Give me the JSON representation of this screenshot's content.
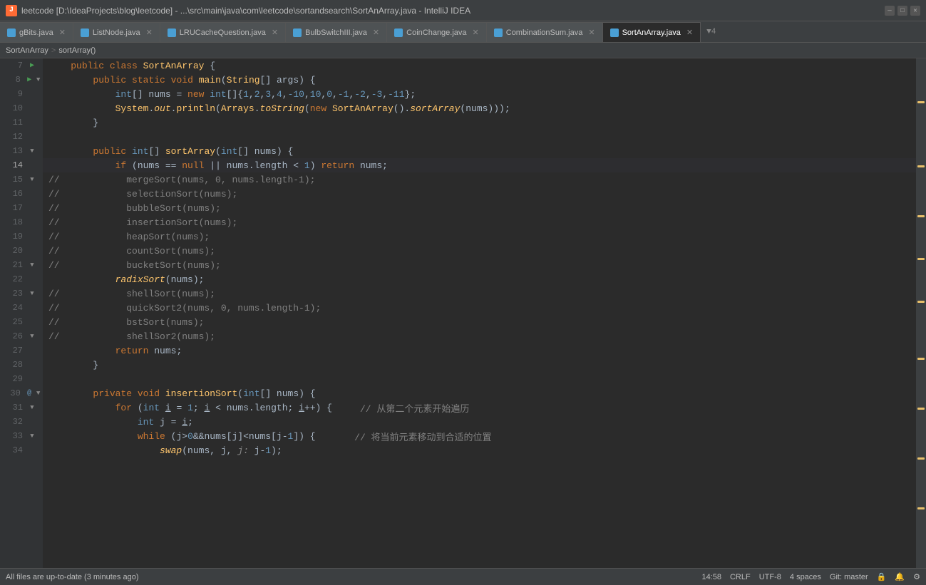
{
  "titleBar": {
    "title": "leetcode [D:\\IdeaProjects\\blog\\leetcode] - ...\\src\\main\\java\\com\\leetcode\\sortandsearch\\SortAnArray.java - IntelliJ IDEA",
    "appIcon": "J",
    "winBtns": [
      "—",
      "□",
      "✕"
    ]
  },
  "tabs": [
    {
      "id": "gBits",
      "label": "gBits.java",
      "active": false
    },
    {
      "id": "listNode",
      "label": "ListNode.java",
      "active": false
    },
    {
      "id": "lruCache",
      "label": "LRUCacheQuestion.java",
      "active": false
    },
    {
      "id": "bulbSwitch",
      "label": "BulbSwitchIII.java",
      "active": false
    },
    {
      "id": "coinChange",
      "label": "CoinChange.java",
      "active": false
    },
    {
      "id": "combinationSum",
      "label": "CombinationSum.java",
      "active": false
    },
    {
      "id": "sortAnArray",
      "label": "SortAnArray.java",
      "active": true
    }
  ],
  "tabOverflow": "▼4",
  "breadcrumb": {
    "parts": [
      "SortAnArray",
      ">",
      "sortArray()"
    ]
  },
  "lines": [
    {
      "num": 7,
      "runIcon": true,
      "foldIcon": false,
      "code": "    public class SortAnArray {"
    },
    {
      "num": 8,
      "runIcon": true,
      "foldIcon": true,
      "code": "        public static void main(String[] args) {"
    },
    {
      "num": 9,
      "foldIcon": false,
      "code": "            int[] nums = new int[]{1,2,3,4,-10,10,0,-1,-2,-3,-11};"
    },
    {
      "num": 10,
      "foldIcon": false,
      "code": "            System.out.println(Arrays.toString(new SortAnArray().sortArray(nums)));"
    },
    {
      "num": 11,
      "foldIcon": false,
      "code": "        }"
    },
    {
      "num": 12,
      "foldIcon": false,
      "code": ""
    },
    {
      "num": 13,
      "foldIcon": false,
      "code": "        public int[] sortArray(int[] nums) {"
    },
    {
      "num": 14,
      "foldIcon": false,
      "cursor": true,
      "code": "            if (nums == null || nums.length < 1) return nums;"
    },
    {
      "num": 15,
      "foldIcon": true,
      "commented": true,
      "code": "//            mergeSort(nums, 0, nums.length-1);"
    },
    {
      "num": 16,
      "foldIcon": false,
      "commented": true,
      "code": "//            selectionSort(nums);"
    },
    {
      "num": 17,
      "foldIcon": false,
      "commented": true,
      "code": "//            bubbleSort(nums);"
    },
    {
      "num": 18,
      "foldIcon": false,
      "commented": true,
      "code": "//            insertionSort(nums);"
    },
    {
      "num": 19,
      "foldIcon": false,
      "commented": true,
      "code": "//            heapSort(nums);"
    },
    {
      "num": 20,
      "foldIcon": false,
      "commented": true,
      "code": "//            countSort(nums);"
    },
    {
      "num": 21,
      "foldIcon": true,
      "commented": true,
      "code": "//            bucketSort(nums);"
    },
    {
      "num": 22,
      "foldIcon": false,
      "code": "            radixSort(nums);"
    },
    {
      "num": 23,
      "foldIcon": true,
      "commented": true,
      "code": "//            shellSort(nums);"
    },
    {
      "num": 24,
      "foldIcon": false,
      "commented": true,
      "code": "//            quickSort2(nums, 0, nums.length-1);"
    },
    {
      "num": 25,
      "foldIcon": false,
      "commented": true,
      "code": "//            bstSort(nums);"
    },
    {
      "num": 26,
      "foldIcon": true,
      "commented": true,
      "code": "//            shellSor2(nums);"
    },
    {
      "num": 27,
      "foldIcon": false,
      "code": "            return nums;"
    },
    {
      "num": 28,
      "foldIcon": false,
      "code": "        }"
    },
    {
      "num": 29,
      "foldIcon": false,
      "code": ""
    },
    {
      "num": 30,
      "annotation": true,
      "foldIcon": true,
      "code": "        private void insertionSort(int[] nums) {"
    },
    {
      "num": 31,
      "foldIcon": true,
      "code": "            for (int i = 1; i < nums.length; i++) {     // 从第二个元素开始遍历"
    },
    {
      "num": 32,
      "foldIcon": false,
      "code": "                int j = i;"
    },
    {
      "num": 33,
      "foldIcon": true,
      "code": "                while (j>0&&nums[j]<nums[j-1]) {       // 将当前元素移动到合适的位置"
    },
    {
      "num": 34,
      "foldIcon": false,
      "code": "                    swap(nums, j, j-1);"
    }
  ],
  "statusBar": {
    "left": "All files are up-to-date (3 minutes ago)",
    "time": "14:58",
    "lineEnding": "CRLF",
    "encoding": "UTF-8",
    "indent": "4 spaces",
    "git": "Git: master"
  },
  "colors": {
    "keyword": "#cc7832",
    "type": "#6897bb",
    "string": "#6a8759",
    "comment": "#808080",
    "function": "#ffc66d",
    "annotation": "#bbb529",
    "accent": "#499c54"
  }
}
